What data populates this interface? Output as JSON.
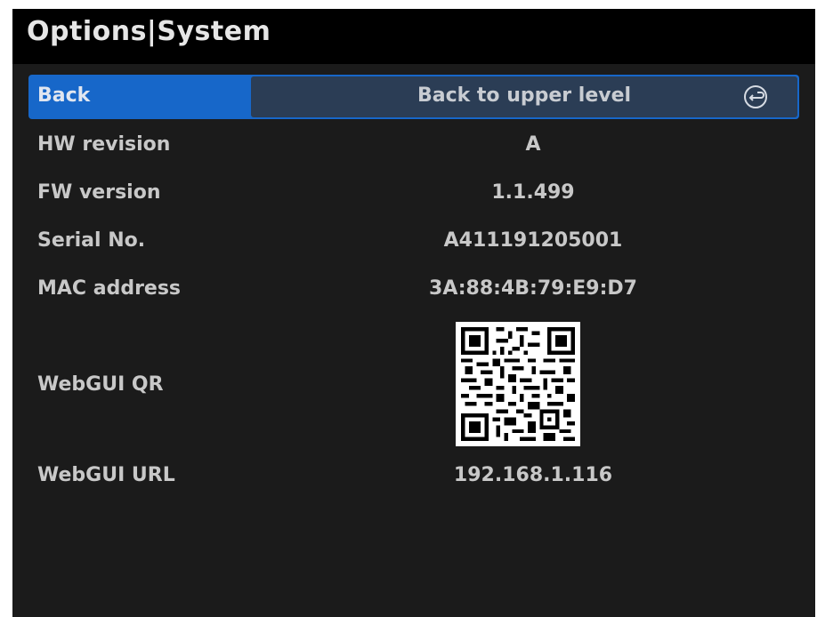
{
  "header": {
    "title": "Options|System"
  },
  "back": {
    "label": "Back",
    "value": "Back to upper level",
    "icon": "back-arrow-circle-icon"
  },
  "rows": [
    {
      "label": "HW revision",
      "value": "A"
    },
    {
      "label": "FW version",
      "value": "1.1.499"
    },
    {
      "label": "Serial No.",
      "value": "A411191205001"
    },
    {
      "label": "MAC address",
      "value": "3A:88:4B:79:E9:D7"
    },
    {
      "label": "WebGUI QR"
    },
    {
      "label": "WebGUI URL",
      "value": "192.168.1.116"
    }
  ],
  "colors": {
    "background": "#1b1b1b",
    "titlebar": "#000000",
    "highlight": "#1767c9",
    "highlight_value_box": "#2b3d55",
    "text": "#c8c8c8"
  }
}
